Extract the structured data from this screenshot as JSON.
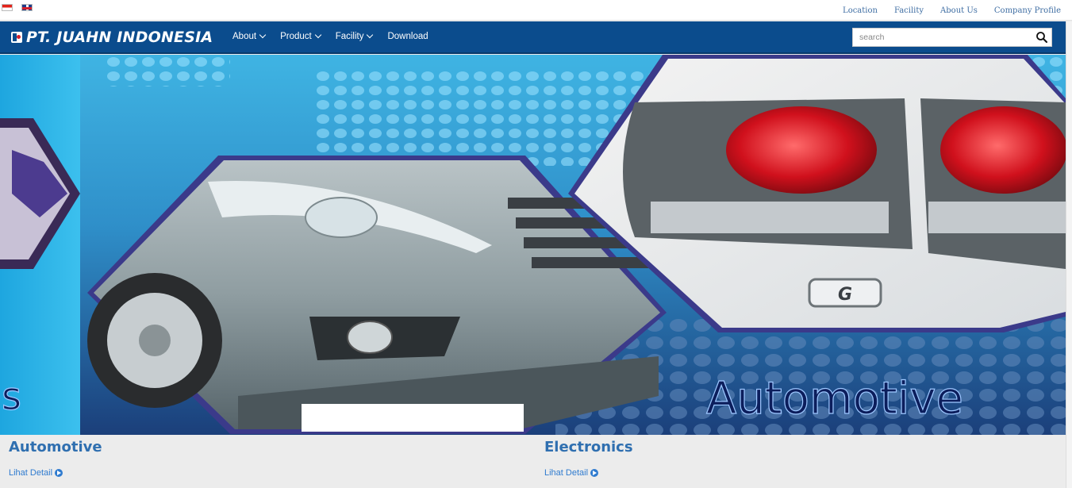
{
  "topbar": {
    "flags": [
      {
        "icon": "flag-indonesia-icon"
      },
      {
        "icon": "flag-uk-icon"
      }
    ],
    "links": [
      "Location",
      "Facility",
      "About Us",
      "Company Profile"
    ]
  },
  "header": {
    "logo_text": "PT. JUAHN INDONESIA",
    "menu": [
      {
        "label": "About",
        "dropdown": true
      },
      {
        "label": "Product",
        "dropdown": true
      },
      {
        "label": "Facility",
        "dropdown": true
      },
      {
        "label": "Download",
        "dropdown": false
      }
    ],
    "search": {
      "placeholder": "search",
      "value": "",
      "icon": "search-icon"
    }
  },
  "hero": {
    "caption": "Automotive",
    "left_caption_fragment": "s"
  },
  "categories": [
    {
      "title": "Automotive",
      "link": "Lihat Detail"
    },
    {
      "title": "Electronics",
      "link": "Lihat Detail"
    }
  ],
  "colors": {
    "nav_bg": "#0b4c8d",
    "link_blue": "#3f6ea3",
    "category_title": "#2f6fb0",
    "detail_link": "#2f7bcf"
  }
}
